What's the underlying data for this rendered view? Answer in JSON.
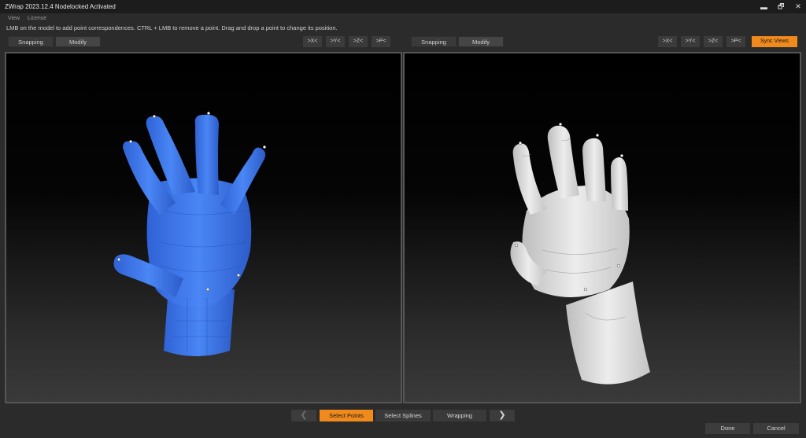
{
  "window": {
    "title": "ZWrap 2023.12.4  Nodelocked Activated",
    "controls": {
      "minimize": "▬",
      "restore": "🗗",
      "close": "✕"
    }
  },
  "menu": [
    "View",
    "License"
  ],
  "hint": "LMB on the model to add point correspondences. CTRL + LMB to remove a point. Drag and drop a point to change its position.",
  "left_toolbar": {
    "snapping": "Snapping",
    "modify": "Modify",
    "axes": [
      ">X<",
      ">Y<",
      ">Z<",
      ">P<"
    ]
  },
  "right_toolbar": {
    "snapping": "Snapping",
    "modify": "Modify",
    "axes": [
      ">X<",
      ">Y<",
      ">Z<",
      ">P<"
    ],
    "sync": "Sync Views"
  },
  "steps": {
    "prev_arrow": "❮",
    "next_arrow": "❯",
    "items": [
      "Select Points",
      "Select Splines",
      "Wrapping"
    ],
    "active": "Select Points"
  },
  "footer": {
    "done": "Done",
    "cancel": "Cancel"
  },
  "colors": {
    "accent": "#f08a1c",
    "source_mesh": "#3f79ef",
    "target_mesh": "#d9d9d9"
  }
}
